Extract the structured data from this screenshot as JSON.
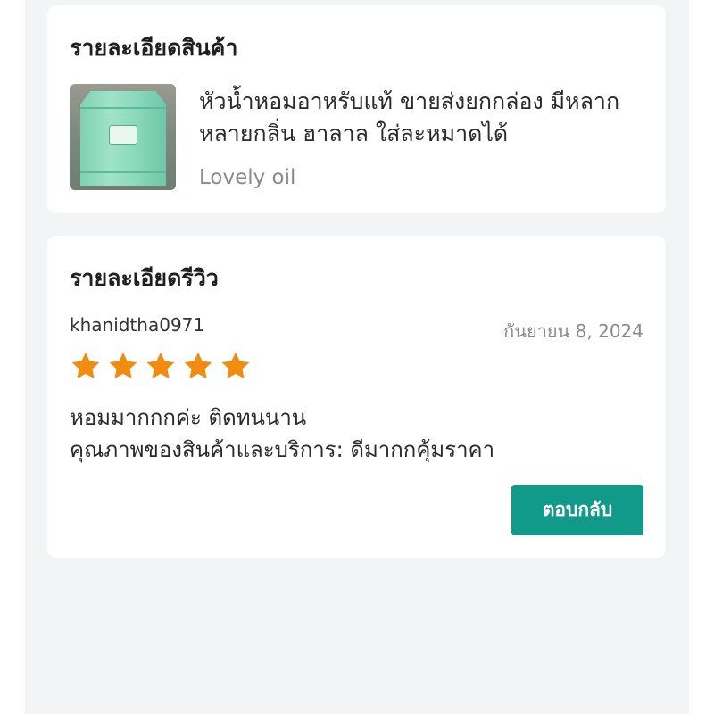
{
  "product_section": {
    "title": "รายละเอียดสินค้า",
    "product_name": "หัวน้ำหอมอาหรับแท้ ขายส่งยกกล่อง มีหลากหลายกลิ่น ฮาลาล ใส่ละหมาดได้",
    "variant": "Lovely oil",
    "thumbnail": "perfume-box-photo"
  },
  "review_section": {
    "title": "รายละเอียดรีวิว",
    "reviewer": "khanidtha0971",
    "date": "กันยายน 8, 2024",
    "rating": 5,
    "max_rating": 5,
    "star_color": "#f28c0f",
    "comment_line1": "หอมมากกกค่ะ ติดทนนาน",
    "comment_line2": "คุณภาพของสินค้าและบริการ: ดีมากกคุ้มราคา",
    "reply_label": "ตอบกลับ"
  },
  "colors": {
    "accent": "#11998a",
    "background": "#f3f4f6",
    "card": "#ffffff"
  }
}
